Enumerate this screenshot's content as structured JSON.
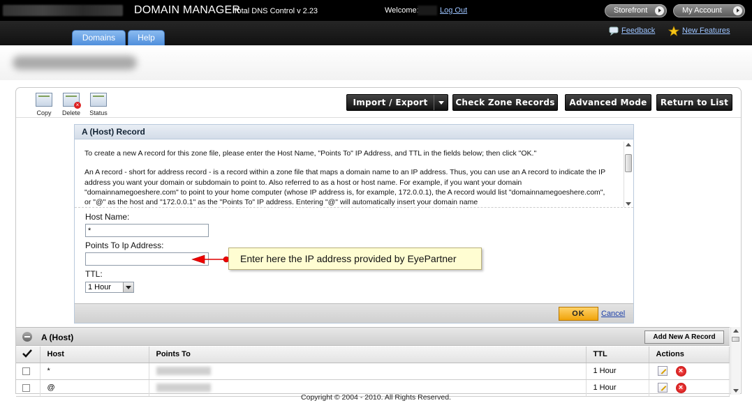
{
  "header": {
    "app_name": "DOMAIN MANAGER",
    "app_version": "Total DNS Control v 2.23",
    "welcome": "Welcome:",
    "logout": "Log Out",
    "storefront": "Storefront",
    "my_account": "My Account"
  },
  "nav": {
    "tabs": [
      {
        "label": "Domains"
      },
      {
        "label": "Help"
      }
    ],
    "feedback": "Feedback",
    "new_features": "New Features"
  },
  "toolbar": {
    "copy": "Copy",
    "delete": "Delete",
    "status": "Status",
    "import_export": "Import / Export",
    "check_zone": "Check Zone Records",
    "advanced_mode": "Advanced Mode",
    "return_to_list": "Return to List"
  },
  "form": {
    "title": "A (Host) Record",
    "desc_p1": "To create a new A record for this zone file, please enter the Host Name, \"Points To\" IP Address, and TTL in the fields below; then click \"OK.\"",
    "desc_p2": "An A record - short for address record - is a record within a zone file that maps a domain name to an IP address. Thus, you can use an A record to indicate the IP address you want your domain or subdomain to point to. Also referred to as a host or host name. For example, if you want your domain \"domainnamegoeshere.com\" to point to your home computer (whose IP address is, for example, 172.0.0.1), the A record would list \"domainnamegoeshere.com\", or \"@\" as the host and \"172.0.0.1\" as the \"Points To\" IP address. Entering \"@\" will automatically insert your domain name",
    "host_label": "Host Name:",
    "host_value": "*",
    "points_label": "Points To Ip Address:",
    "points_value": "",
    "ttl_label": "TTL:",
    "ttl_value": "1 Hour",
    "ok": "OK",
    "cancel": "Cancel"
  },
  "callout": {
    "text": "Enter here the IP address provided by EyePartner"
  },
  "records": {
    "title": "A (Host)",
    "add_new": "Add New A Record",
    "columns": {
      "host": "Host",
      "points_to": "Points To",
      "ttl": "TTL",
      "actions": "Actions"
    },
    "rows": [
      {
        "host": "*",
        "ttl": "1 Hour"
      },
      {
        "host": "@",
        "ttl": "1 Hour"
      }
    ]
  },
  "footer": {
    "copyright": "Copyright © 2004 - 2010. All Rights Reserved."
  },
  "colors": {
    "accent_blue": "#4f8fdc",
    "ok_orange": "#f0a30a",
    "delete_red": "#cc0000",
    "callout_bg": "#fffdd2"
  }
}
